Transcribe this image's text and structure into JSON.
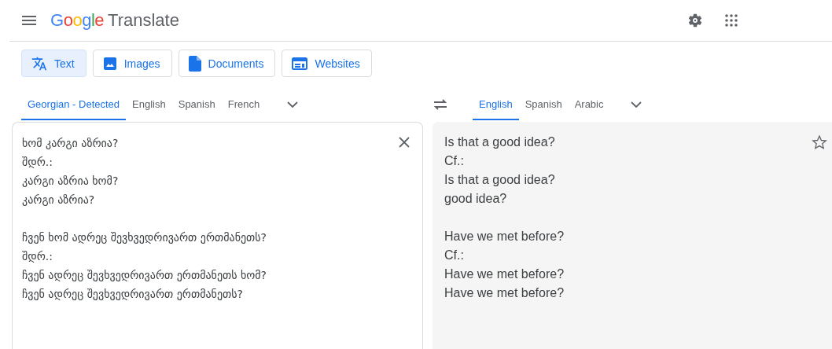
{
  "header": {
    "logo_word": "Google",
    "product": "Translate"
  },
  "modes": [
    {
      "label": "Text",
      "kind": "text",
      "selected": true
    },
    {
      "label": "Images",
      "kind": "images",
      "selected": false
    },
    {
      "label": "Documents",
      "kind": "documents",
      "selected": false
    },
    {
      "label": "Websites",
      "kind": "websites",
      "selected": false
    }
  ],
  "source_languages": [
    {
      "label": "Georgian - Detected",
      "selected": true
    },
    {
      "label": "English",
      "selected": false
    },
    {
      "label": "Spanish",
      "selected": false
    },
    {
      "label": "French",
      "selected": false
    }
  ],
  "target_languages": [
    {
      "label": "English",
      "selected": true
    },
    {
      "label": "Spanish",
      "selected": false
    },
    {
      "label": "Arabic",
      "selected": false
    }
  ],
  "source_text": [
    [
      "ხომ კარგი აზრია?",
      "შდრ.:",
      "კარგი აზრია ხომ?",
      "კარგი აზრია?"
    ],
    [
      "ჩვენ ხომ ადრეც შევხვედრივართ ერთმანეთს?",
      "შდრ.:",
      "ჩვენ ადრეც შევხვედრივართ ერთმანეთს ხომ?",
      "ჩვენ ადრეც შევხვედრივართ ერთმანეთს?"
    ]
  ],
  "translation": [
    [
      "Is that a good idea?",
      "Cf.:",
      "Is that a good idea?",
      "good idea?"
    ],
    [
      "Have we met before?",
      "Cf.:",
      "Have we met before?",
      "Have we met before?"
    ]
  ]
}
